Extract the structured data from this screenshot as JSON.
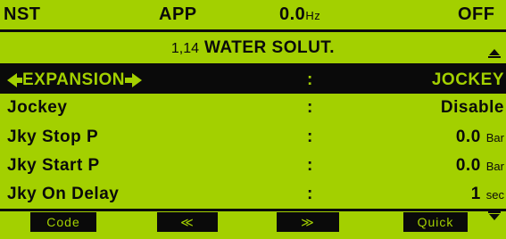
{
  "status": {
    "mode": "NST",
    "app": "APP",
    "freq_value": "0.0",
    "freq_unit": "Hz",
    "state": "OFF"
  },
  "menu": {
    "number": "1,14",
    "title": "WATER SOLUT."
  },
  "rows": [
    {
      "label": "EXPANSION",
      "sep": ":",
      "value": "JOCKEY",
      "unit": ""
    },
    {
      "label": "Jockey",
      "sep": ":",
      "value": "Disable",
      "unit": ""
    },
    {
      "label": "Jky Stop P",
      "sep": ":",
      "value": "0.0",
      "unit": "Bar"
    },
    {
      "label": "Jky Start P",
      "sep": ":",
      "value": "0.0",
      "unit": "Bar"
    },
    {
      "label": "Jky On Delay",
      "sep": ":",
      "value": "1",
      "unit": "sec"
    }
  ],
  "softkeys": {
    "k1": "Code",
    "k2": "≪",
    "k3": "≫",
    "k4": "Quick"
  },
  "colors": {
    "background": "#a3d000",
    "foreground": "#0a0a0a"
  }
}
